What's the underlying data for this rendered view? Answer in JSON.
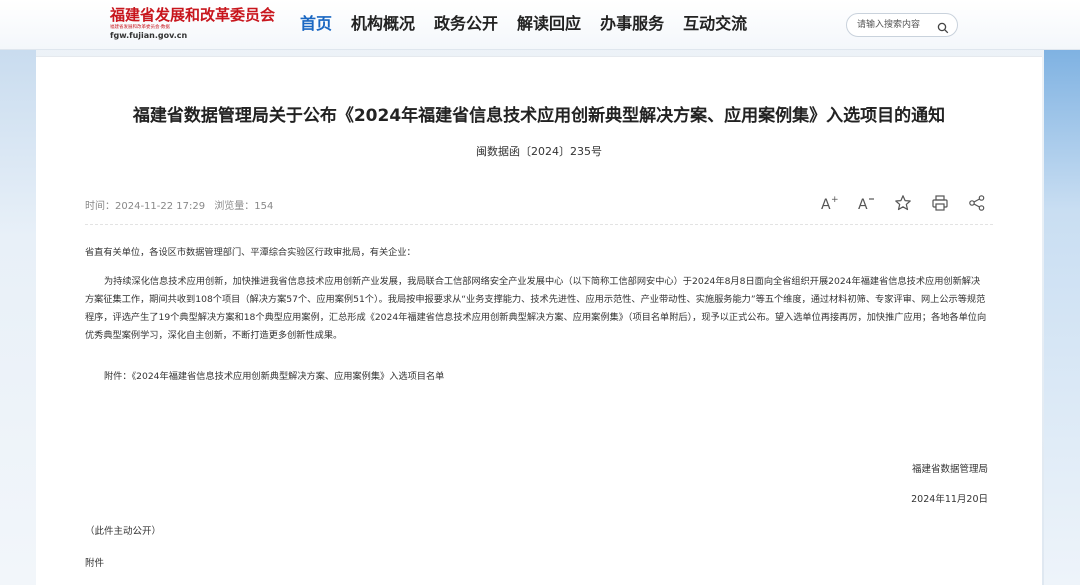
{
  "header": {
    "logo_main": "福建省发展和改革委员会",
    "logo_sub": "福建省发展和改革委员会·数据",
    "logo_url": "fgw.fujian.gov.cn",
    "nav": [
      "首页",
      "机构概况",
      "政务公开",
      "解读回应",
      "办事服务",
      "互动交流"
    ],
    "active_nav": "首页",
    "search_placeholder": "请输入搜索内容"
  },
  "article": {
    "title": "福建省数据管理局关于公布《2024年福建省信息技术应用创新典型解决方案、应用案例集》入选项目的通知",
    "doc_number": "闽数据函〔2024〕235号",
    "time_label": "时间：2024-11-22 17:29",
    "views_label": "浏览量：154",
    "greeting": "省直有关单位，各设区市数据管理部门、平潭综合实验区行政审批局，有关企业：",
    "body": "为持续深化信息技术应用创新，加快推进我省信息技术应用创新产业发展，我局联合工信部网络安全产业发展中心（以下简称工信部网安中心）于2024年8月8日面向全省组织开展2024年福建省信息技术应用创新解决方案征集工作，期间共收到108个项目（解决方案57个、应用案例51个）。我局按申报要求从“业务支撑能力、技术先进性、应用示范性、产业带动性、实施服务能力”等五个维度，通过材料初筛、专家评审、网上公示等规范程序，评选产生了19个典型解决方案和18个典型应用案例，汇总形成《2024年福建省信息技术应用创新典型解决方案、应用案例集》（项目名单附后），现予以正式公布。望入选单位再接再厉，加快推广应用；各地各单位向优秀典型案例学习，深化自主创新，不断打造更多创新性成果。",
    "attachment_line": "附件：《2024年福建省信息技术应用创新典型解决方案、应用案例集》入选项目名单",
    "signature_org": "福建省数据管理局",
    "signature_date": "2024年11月20日",
    "public_note": "（此件主动公开）",
    "attachment_heading": "附件"
  },
  "colors": {
    "accent": "#1a67c2",
    "brand_red": "#c8161d"
  },
  "icons": [
    "font-increase-icon",
    "font-decrease-icon",
    "star-icon",
    "print-icon",
    "share-icon",
    "search-icon"
  ]
}
